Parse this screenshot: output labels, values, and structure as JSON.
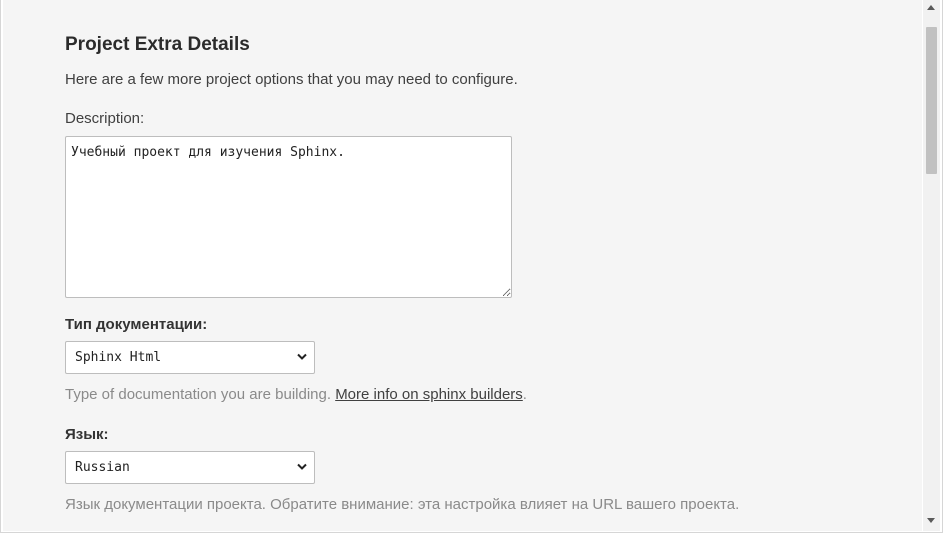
{
  "section": {
    "title": "Project Extra Details",
    "intro": "Here are a few more project options that you may need to configure."
  },
  "description": {
    "label": "Description:",
    "value": "Учебный проект для изучения Sphinx."
  },
  "doc_type": {
    "label": "Тип документации:",
    "selected": "Sphinx Html",
    "help_text": "Type of documentation you are building. ",
    "help_link": "More info on sphinx builders",
    "help_suffix": "."
  },
  "language": {
    "label": "Язык:",
    "selected": "Russian",
    "help_text": "Язык документации проекта. Обратите внимание: эта настройка влияет на URL вашего проекта."
  },
  "icons": {
    "select_arrow": "chevron-down-icon",
    "scroll_up": "scroll-up-arrow-icon",
    "scroll_down": "scroll-down-arrow-icon"
  }
}
